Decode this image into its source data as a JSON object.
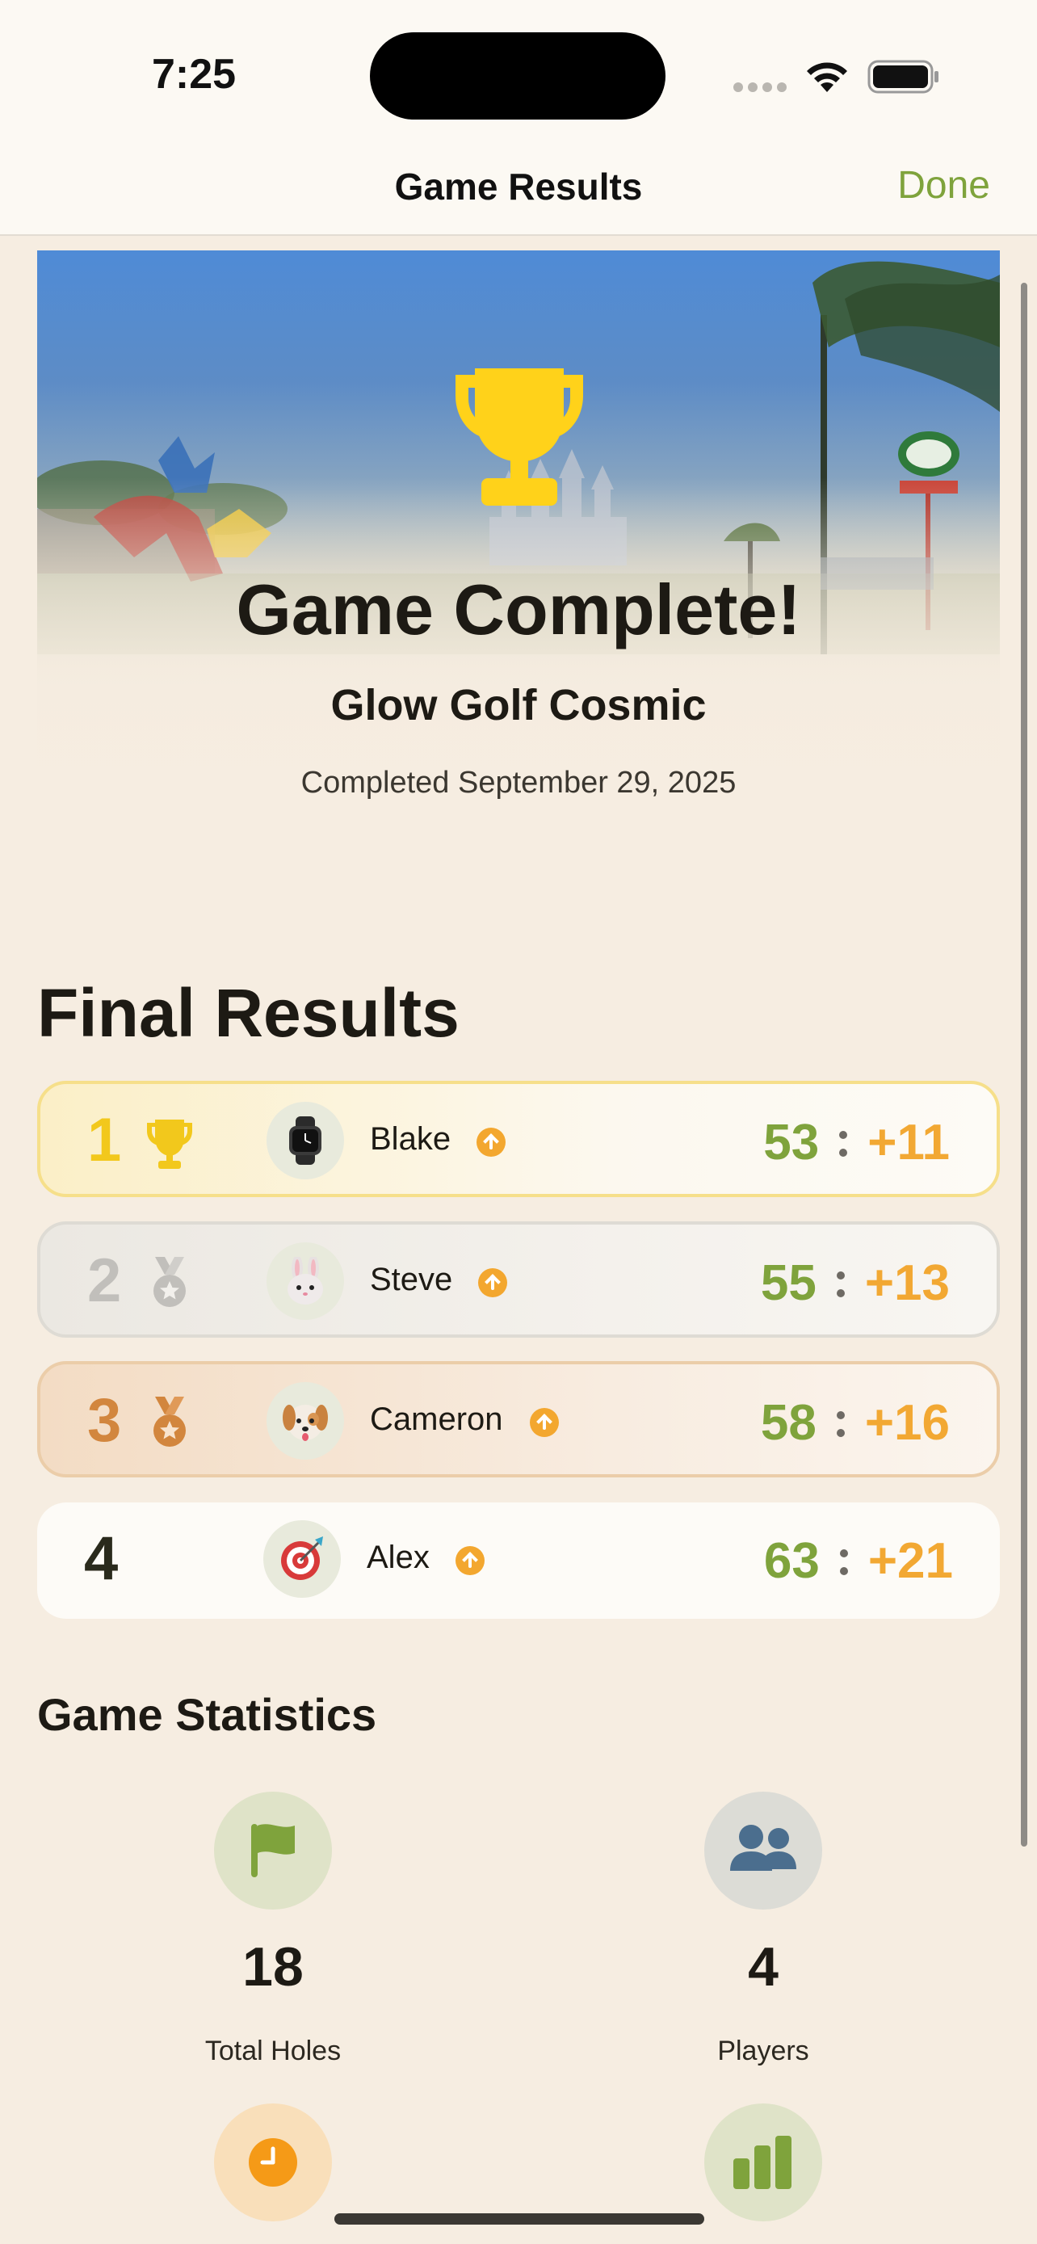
{
  "status_bar": {
    "time": "7:25"
  },
  "nav": {
    "title": "Game Results",
    "done_label": "Done"
  },
  "hero": {
    "title": "Game Complete!",
    "course_name": "Glow Golf Cosmic",
    "completed_text": "Completed September 29, 2025",
    "trophy_color": "#FFD21A"
  },
  "results": {
    "title": "Final Results",
    "rows": [
      {
        "rank": "1",
        "rank_icon": "trophy-icon",
        "avatar_icon": "watch-icon",
        "name": "Blake",
        "strokes": "53",
        "to_par": "+11"
      },
      {
        "rank": "2",
        "rank_icon": "silver-medal-icon",
        "avatar_icon": "rabbit-icon",
        "name": "Steve",
        "strokes": "55",
        "to_par": "+13"
      },
      {
        "rank": "3",
        "rank_icon": "bronze-medal-icon",
        "avatar_icon": "dog-icon",
        "name": "Cameron",
        "strokes": "58",
        "to_par": "+16"
      },
      {
        "rank": "4",
        "rank_icon": "",
        "avatar_icon": "target-icon",
        "name": "Alex",
        "strokes": "63",
        "to_par": "+21"
      }
    ]
  },
  "statistics": {
    "title": "Game Statistics",
    "items": [
      {
        "value": "18",
        "label": "Total Holes",
        "icon": "flag-icon"
      },
      {
        "value": "4",
        "label": "Players",
        "icon": "people-icon"
      },
      {
        "value": "",
        "label": "",
        "icon": "clock-icon"
      },
      {
        "value": "",
        "label": "",
        "icon": "bar-chart-icon"
      }
    ]
  },
  "colors": {
    "accent_green": "#7FA33C",
    "accent_orange": "#F2A833",
    "gold": "#F2C81C",
    "silver": "#C1BFBB",
    "bronze": "#D2863E",
    "background": "#F6EDE1"
  }
}
